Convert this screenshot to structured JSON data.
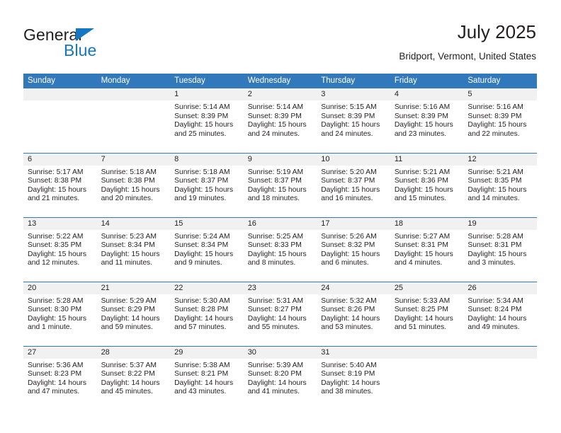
{
  "brand": {
    "name_top": "General",
    "name_bottom": "Blue",
    "triangle_color": "#1577c1",
    "text_color": "#231f20"
  },
  "header": {
    "title": "July 2025",
    "subtitle": "Bridport, Vermont, United States"
  },
  "theme": {
    "header_bg": "#3279bb",
    "header_text": "#ffffff",
    "daynum_band_bg": "#f1f1f1",
    "row_divider": "#3279bb",
    "body_text": "#231f20"
  },
  "weekday_headers": [
    "Sunday",
    "Monday",
    "Tuesday",
    "Wednesday",
    "Thursday",
    "Friday",
    "Saturday"
  ],
  "weeks": [
    [
      {
        "day": "",
        "sunrise": "",
        "sunset": "",
        "daylight_line1": "",
        "daylight_line2": ""
      },
      {
        "day": "",
        "sunrise": "",
        "sunset": "",
        "daylight_line1": "",
        "daylight_line2": ""
      },
      {
        "day": "1",
        "sunrise": "Sunrise: 5:14 AM",
        "sunset": "Sunset: 8:39 PM",
        "daylight_line1": "Daylight: 15 hours",
        "daylight_line2": "and 25 minutes."
      },
      {
        "day": "2",
        "sunrise": "Sunrise: 5:14 AM",
        "sunset": "Sunset: 8:39 PM",
        "daylight_line1": "Daylight: 15 hours",
        "daylight_line2": "and 24 minutes."
      },
      {
        "day": "3",
        "sunrise": "Sunrise: 5:15 AM",
        "sunset": "Sunset: 8:39 PM",
        "daylight_line1": "Daylight: 15 hours",
        "daylight_line2": "and 24 minutes."
      },
      {
        "day": "4",
        "sunrise": "Sunrise: 5:16 AM",
        "sunset": "Sunset: 8:39 PM",
        "daylight_line1": "Daylight: 15 hours",
        "daylight_line2": "and 23 minutes."
      },
      {
        "day": "5",
        "sunrise": "Sunrise: 5:16 AM",
        "sunset": "Sunset: 8:39 PM",
        "daylight_line1": "Daylight: 15 hours",
        "daylight_line2": "and 22 minutes."
      }
    ],
    [
      {
        "day": "6",
        "sunrise": "Sunrise: 5:17 AM",
        "sunset": "Sunset: 8:38 PM",
        "daylight_line1": "Daylight: 15 hours",
        "daylight_line2": "and 21 minutes."
      },
      {
        "day": "7",
        "sunrise": "Sunrise: 5:18 AM",
        "sunset": "Sunset: 8:38 PM",
        "daylight_line1": "Daylight: 15 hours",
        "daylight_line2": "and 20 minutes."
      },
      {
        "day": "8",
        "sunrise": "Sunrise: 5:18 AM",
        "sunset": "Sunset: 8:37 PM",
        "daylight_line1": "Daylight: 15 hours",
        "daylight_line2": "and 19 minutes."
      },
      {
        "day": "9",
        "sunrise": "Sunrise: 5:19 AM",
        "sunset": "Sunset: 8:37 PM",
        "daylight_line1": "Daylight: 15 hours",
        "daylight_line2": "and 18 minutes."
      },
      {
        "day": "10",
        "sunrise": "Sunrise: 5:20 AM",
        "sunset": "Sunset: 8:37 PM",
        "daylight_line1": "Daylight: 15 hours",
        "daylight_line2": "and 16 minutes."
      },
      {
        "day": "11",
        "sunrise": "Sunrise: 5:21 AM",
        "sunset": "Sunset: 8:36 PM",
        "daylight_line1": "Daylight: 15 hours",
        "daylight_line2": "and 15 minutes."
      },
      {
        "day": "12",
        "sunrise": "Sunrise: 5:21 AM",
        "sunset": "Sunset: 8:35 PM",
        "daylight_line1": "Daylight: 15 hours",
        "daylight_line2": "and 14 minutes."
      }
    ],
    [
      {
        "day": "13",
        "sunrise": "Sunrise: 5:22 AM",
        "sunset": "Sunset: 8:35 PM",
        "daylight_line1": "Daylight: 15 hours",
        "daylight_line2": "and 12 minutes."
      },
      {
        "day": "14",
        "sunrise": "Sunrise: 5:23 AM",
        "sunset": "Sunset: 8:34 PM",
        "daylight_line1": "Daylight: 15 hours",
        "daylight_line2": "and 11 minutes."
      },
      {
        "day": "15",
        "sunrise": "Sunrise: 5:24 AM",
        "sunset": "Sunset: 8:34 PM",
        "daylight_line1": "Daylight: 15 hours",
        "daylight_line2": "and 9 minutes."
      },
      {
        "day": "16",
        "sunrise": "Sunrise: 5:25 AM",
        "sunset": "Sunset: 8:33 PM",
        "daylight_line1": "Daylight: 15 hours",
        "daylight_line2": "and 8 minutes."
      },
      {
        "day": "17",
        "sunrise": "Sunrise: 5:26 AM",
        "sunset": "Sunset: 8:32 PM",
        "daylight_line1": "Daylight: 15 hours",
        "daylight_line2": "and 6 minutes."
      },
      {
        "day": "18",
        "sunrise": "Sunrise: 5:27 AM",
        "sunset": "Sunset: 8:31 PM",
        "daylight_line1": "Daylight: 15 hours",
        "daylight_line2": "and 4 minutes."
      },
      {
        "day": "19",
        "sunrise": "Sunrise: 5:28 AM",
        "sunset": "Sunset: 8:31 PM",
        "daylight_line1": "Daylight: 15 hours",
        "daylight_line2": "and 3 minutes."
      }
    ],
    [
      {
        "day": "20",
        "sunrise": "Sunrise: 5:28 AM",
        "sunset": "Sunset: 8:30 PM",
        "daylight_line1": "Daylight: 15 hours",
        "daylight_line2": "and 1 minute."
      },
      {
        "day": "21",
        "sunrise": "Sunrise: 5:29 AM",
        "sunset": "Sunset: 8:29 PM",
        "daylight_line1": "Daylight: 14 hours",
        "daylight_line2": "and 59 minutes."
      },
      {
        "day": "22",
        "sunrise": "Sunrise: 5:30 AM",
        "sunset": "Sunset: 8:28 PM",
        "daylight_line1": "Daylight: 14 hours",
        "daylight_line2": "and 57 minutes."
      },
      {
        "day": "23",
        "sunrise": "Sunrise: 5:31 AM",
        "sunset": "Sunset: 8:27 PM",
        "daylight_line1": "Daylight: 14 hours",
        "daylight_line2": "and 55 minutes."
      },
      {
        "day": "24",
        "sunrise": "Sunrise: 5:32 AM",
        "sunset": "Sunset: 8:26 PM",
        "daylight_line1": "Daylight: 14 hours",
        "daylight_line2": "and 53 minutes."
      },
      {
        "day": "25",
        "sunrise": "Sunrise: 5:33 AM",
        "sunset": "Sunset: 8:25 PM",
        "daylight_line1": "Daylight: 14 hours",
        "daylight_line2": "and 51 minutes."
      },
      {
        "day": "26",
        "sunrise": "Sunrise: 5:34 AM",
        "sunset": "Sunset: 8:24 PM",
        "daylight_line1": "Daylight: 14 hours",
        "daylight_line2": "and 49 minutes."
      }
    ],
    [
      {
        "day": "27",
        "sunrise": "Sunrise: 5:36 AM",
        "sunset": "Sunset: 8:23 PM",
        "daylight_line1": "Daylight: 14 hours",
        "daylight_line2": "and 47 minutes."
      },
      {
        "day": "28",
        "sunrise": "Sunrise: 5:37 AM",
        "sunset": "Sunset: 8:22 PM",
        "daylight_line1": "Daylight: 14 hours",
        "daylight_line2": "and 45 minutes."
      },
      {
        "day": "29",
        "sunrise": "Sunrise: 5:38 AM",
        "sunset": "Sunset: 8:21 PM",
        "daylight_line1": "Daylight: 14 hours",
        "daylight_line2": "and 43 minutes."
      },
      {
        "day": "30",
        "sunrise": "Sunrise: 5:39 AM",
        "sunset": "Sunset: 8:20 PM",
        "daylight_line1": "Daylight: 14 hours",
        "daylight_line2": "and 41 minutes."
      },
      {
        "day": "31",
        "sunrise": "Sunrise: 5:40 AM",
        "sunset": "Sunset: 8:19 PM",
        "daylight_line1": "Daylight: 14 hours",
        "daylight_line2": "and 38 minutes."
      },
      {
        "day": "",
        "sunrise": "",
        "sunset": "",
        "daylight_line1": "",
        "daylight_line2": ""
      },
      {
        "day": "",
        "sunrise": "",
        "sunset": "",
        "daylight_line1": "",
        "daylight_line2": ""
      }
    ]
  ]
}
